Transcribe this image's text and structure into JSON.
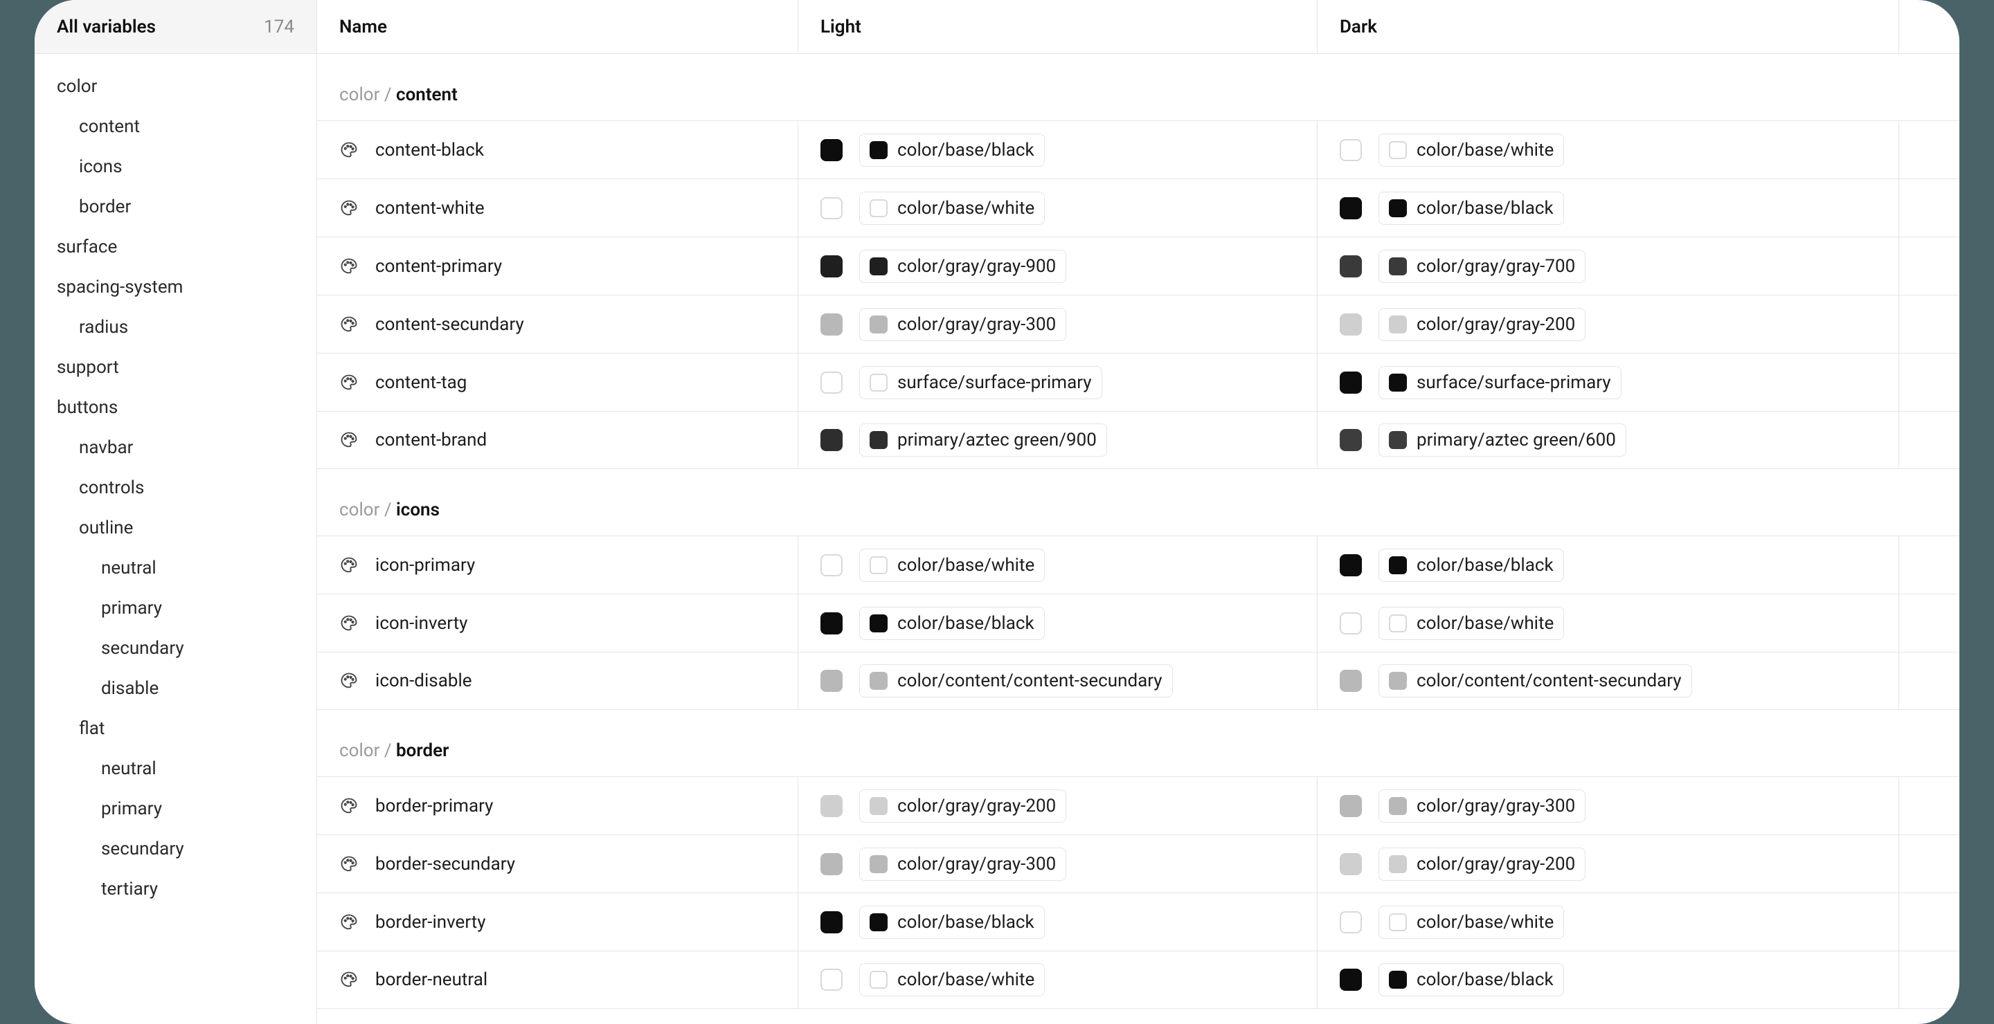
{
  "sidebar": {
    "title": "All variables",
    "count": "174",
    "items": [
      {
        "label": "color",
        "level": 0
      },
      {
        "label": "content",
        "level": 1
      },
      {
        "label": "icons",
        "level": 1
      },
      {
        "label": "border",
        "level": 1
      },
      {
        "label": "surface",
        "level": 0
      },
      {
        "label": "spacing-system",
        "level": 0
      },
      {
        "label": "radius",
        "level": 1
      },
      {
        "label": "support",
        "level": 0
      },
      {
        "label": "buttons",
        "level": 0
      },
      {
        "label": "navbar",
        "level": 1
      },
      {
        "label": "controls",
        "level": 1
      },
      {
        "label": "outline",
        "level": 1
      },
      {
        "label": "neutral",
        "level": 2
      },
      {
        "label": "primary",
        "level": 2
      },
      {
        "label": "secundary",
        "level": 2
      },
      {
        "label": "disable",
        "level": 2
      },
      {
        "label": "flat",
        "level": 1
      },
      {
        "label": "neutral",
        "level": 2
      },
      {
        "label": "primary",
        "level": 2
      },
      {
        "label": "secundary",
        "level": 2
      },
      {
        "label": "tertiary",
        "level": 2
      }
    ]
  },
  "columns": {
    "name": "Name",
    "light": "Light",
    "dark": "Dark"
  },
  "group_prefix": "color / ",
  "swatch_colors": {
    "black": "#0d0d0d",
    "white": "#ffffff",
    "gray900": "#1f1f1f",
    "gray700": "#3a3a3a",
    "gray300": "#b8b8b8",
    "gray200": "#cfcfcf",
    "aztec900": "#2e2e2e",
    "aztec600": "#3d3d3d"
  },
  "groups": [
    {
      "name": "content",
      "rows": [
        {
          "name": "content-black",
          "light": {
            "label": "color/base/black",
            "sw": "black"
          },
          "dark": {
            "label": "color/base/white",
            "sw": "white"
          }
        },
        {
          "name": "content-white",
          "light": {
            "label": "color/base/white",
            "sw": "white"
          },
          "dark": {
            "label": "color/base/black",
            "sw": "black"
          }
        },
        {
          "name": "content-primary",
          "light": {
            "label": "color/gray/gray-900",
            "sw": "gray900"
          },
          "dark": {
            "label": "color/gray/gray-700",
            "sw": "gray700"
          }
        },
        {
          "name": "content-secundary",
          "light": {
            "label": "color/gray/gray-300",
            "sw": "gray300"
          },
          "dark": {
            "label": "color/gray/gray-200",
            "sw": "gray200"
          }
        },
        {
          "name": "content-tag",
          "light": {
            "label": "surface/surface-primary",
            "sw": "white"
          },
          "dark": {
            "label": "surface/surface-primary",
            "sw": "black"
          }
        },
        {
          "name": "content-brand",
          "light": {
            "label": "primary/aztec green/900",
            "sw": "aztec900"
          },
          "dark": {
            "label": "primary/aztec green/600",
            "sw": "aztec600"
          }
        }
      ]
    },
    {
      "name": "icons",
      "rows": [
        {
          "name": "icon-primary",
          "light": {
            "label": "color/base/white",
            "sw": "white"
          },
          "dark": {
            "label": "color/base/black",
            "sw": "black"
          }
        },
        {
          "name": "icon-inverty",
          "light": {
            "label": "color/base/black",
            "sw": "black"
          },
          "dark": {
            "label": "color/base/white",
            "sw": "white"
          }
        },
        {
          "name": "icon-disable",
          "light": {
            "label": "color/content/content-secundary",
            "sw": "gray300"
          },
          "dark": {
            "label": "color/content/content-secundary",
            "sw": "gray300"
          }
        }
      ]
    },
    {
      "name": "border",
      "rows": [
        {
          "name": "border-primary",
          "light": {
            "label": "color/gray/gray-200",
            "sw": "gray200"
          },
          "dark": {
            "label": "color/gray/gray-300",
            "sw": "gray300"
          }
        },
        {
          "name": "border-secundary",
          "light": {
            "label": "color/gray/gray-300",
            "sw": "gray300"
          },
          "dark": {
            "label": "color/gray/gray-200",
            "sw": "gray200"
          }
        },
        {
          "name": "border-inverty",
          "light": {
            "label": "color/base/black",
            "sw": "black"
          },
          "dark": {
            "label": "color/base/white",
            "sw": "white"
          }
        },
        {
          "name": "border-neutral",
          "light": {
            "label": "color/base/white",
            "sw": "white"
          },
          "dark": {
            "label": "color/base/black",
            "sw": "black"
          }
        }
      ]
    }
  ]
}
